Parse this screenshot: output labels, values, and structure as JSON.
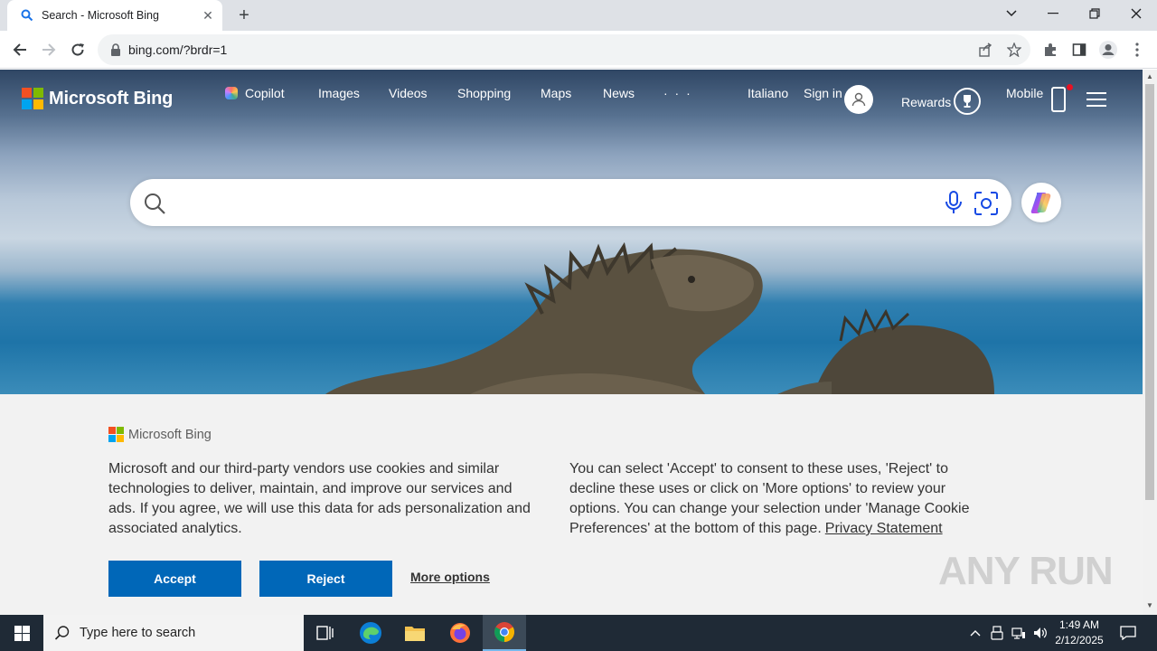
{
  "browser": {
    "tab_title": "Search - Microsoft Bing",
    "new_tab_label": "+",
    "url": "bing.com/?brdr=1"
  },
  "bing": {
    "logo_text": "Microsoft Bing",
    "nav": {
      "copilot": "Copilot",
      "images": "Images",
      "videos": "Videos",
      "shopping": "Shopping",
      "maps": "Maps",
      "news": "News",
      "more": "· · ·"
    },
    "language": "Italiano",
    "sign_in": "Sign in",
    "rewards": "Rewards",
    "mobile": "Mobile",
    "search_placeholder": ""
  },
  "cookie": {
    "logo_text": "Microsoft Bing",
    "text_left": "Microsoft and our third-party vendors use cookies and similar technologies to deliver, maintain, and improve our services and ads. If you agree, we will use this data for ads personalization and associated analytics.",
    "text_right": "You can select 'Accept' to consent to these uses, 'Reject' to decline these uses or click on 'More options' to review your options. You can change your selection under 'Manage Cookie Preferences' at the bottom of this page.",
    "privacy_link": "Privacy Statement",
    "accept": "Accept",
    "reject": "Reject",
    "more_options": "More options"
  },
  "watermark": "ANY RUN",
  "taskbar": {
    "search_placeholder": "Type here to search",
    "time": "1:49 AM",
    "date": "2/12/2025"
  },
  "colors": {
    "accent_blue": "#0067b8",
    "chrome_bar": "#dee1e6",
    "taskbar": "#1f2a36"
  }
}
